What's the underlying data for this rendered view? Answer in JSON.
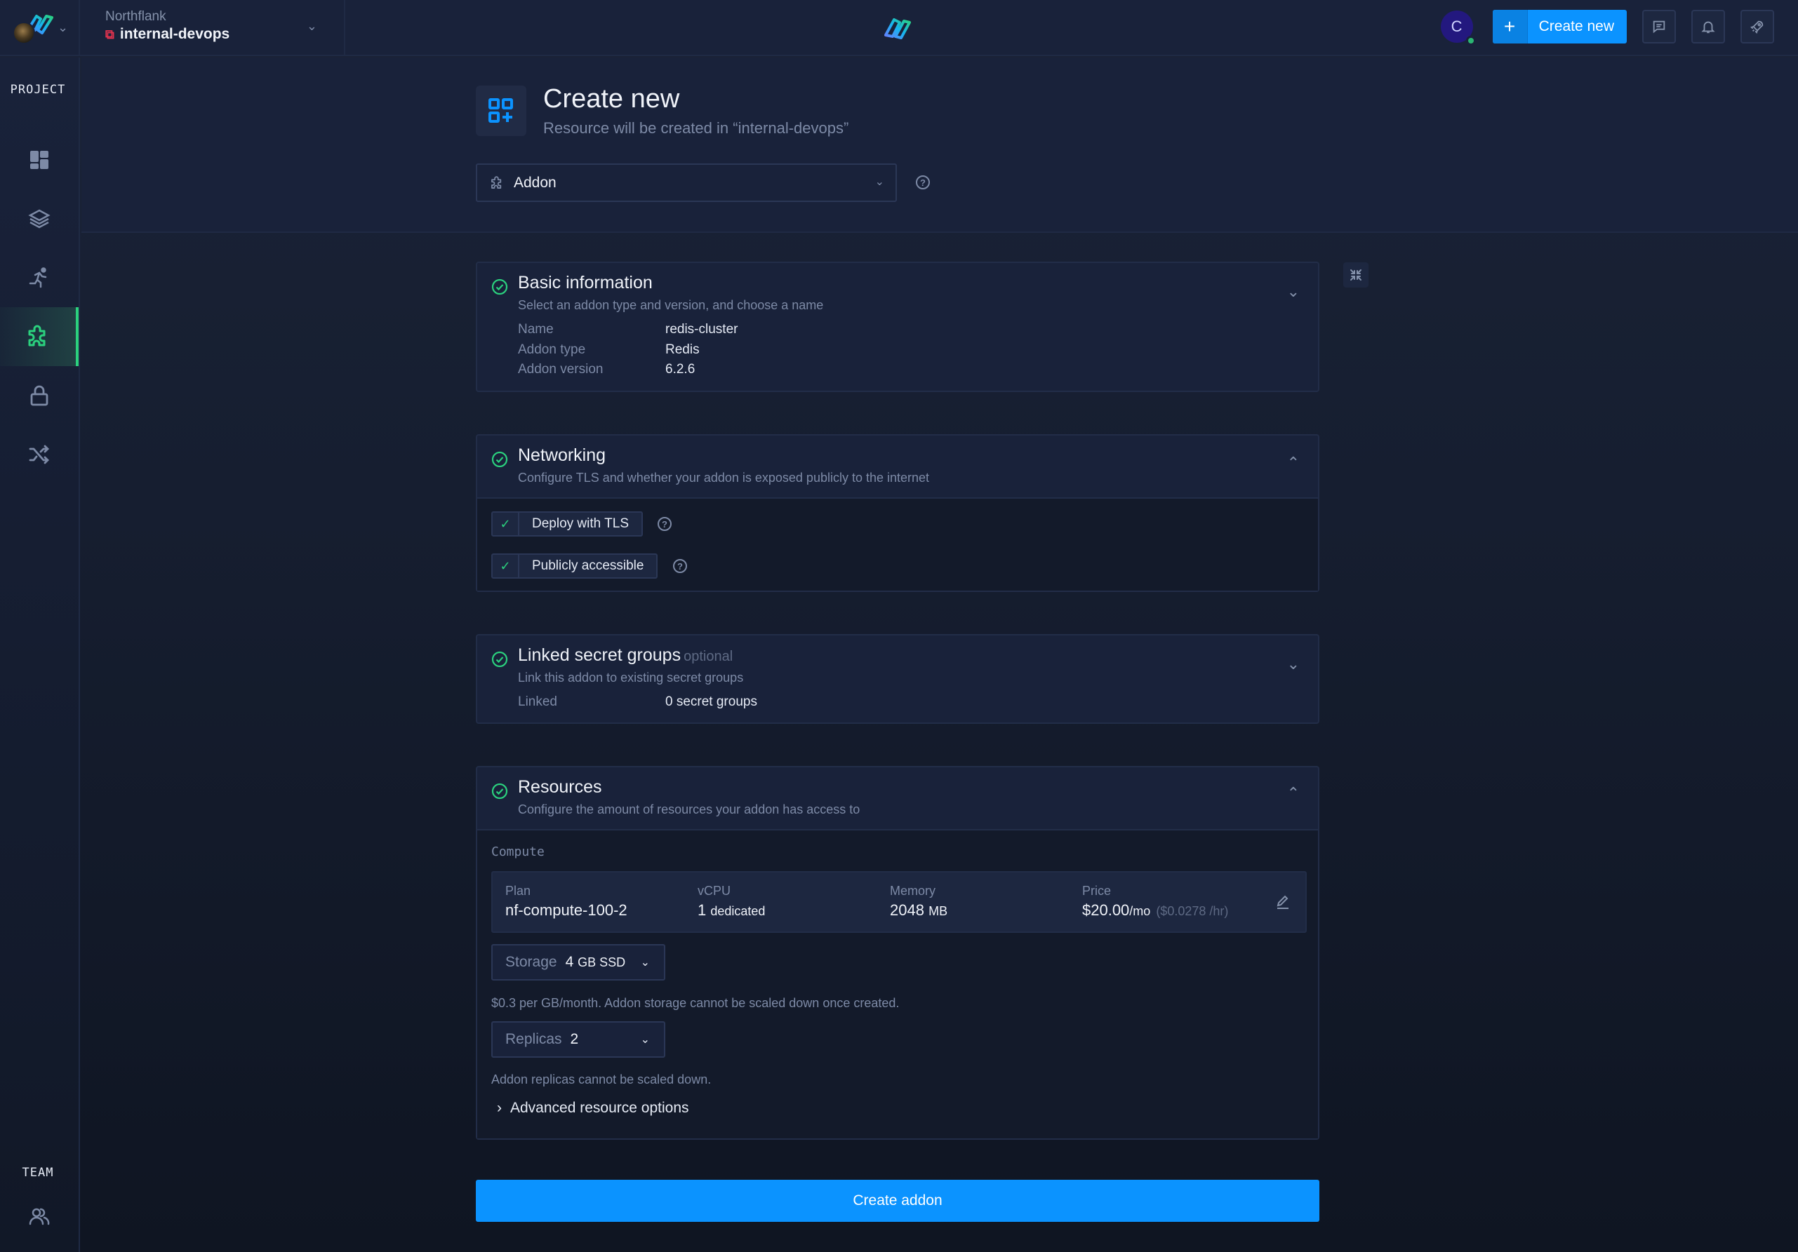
{
  "topbar": {
    "org_name": "Northflank",
    "project_name": "internal-devops",
    "user_initial": "C",
    "create_new_label": "Create new",
    "colors": {
      "primary": "#0b93ff",
      "online": "#2bb673",
      "project_icon": "#e5334e"
    }
  },
  "sidebar": {
    "project_label": "PROJECT",
    "team_label": "TEAM",
    "items": [
      {
        "icon": "dashboard-icon",
        "active": false
      },
      {
        "icon": "layers-icon",
        "active": false
      },
      {
        "icon": "running-job-icon",
        "active": false
      },
      {
        "icon": "puzzle-addon-icon",
        "active": true
      },
      {
        "icon": "lock-secrets-icon",
        "active": false
      },
      {
        "icon": "shuffle-pipeline-icon",
        "active": false
      }
    ],
    "team_items": [
      {
        "icon": "users-icon"
      }
    ],
    "active_color": "#2bd17e"
  },
  "header": {
    "title": "Create new",
    "subtitle": "Resource will be created in “internal-devops”",
    "resource_type": "Addon"
  },
  "sections": {
    "basic": {
      "title": "Basic information",
      "description": "Select an addon type and version, and choose a name",
      "fields": [
        {
          "label": "Name",
          "value": "redis-cluster"
        },
        {
          "label": "Addon type",
          "value": "Redis"
        },
        {
          "label": "Addon version",
          "value": "6.2.6"
        }
      ]
    },
    "networking": {
      "title": "Networking",
      "description": "Configure TLS and whether your addon is exposed publicly to the internet",
      "options": [
        {
          "label": "Deploy with TLS",
          "checked": true
        },
        {
          "label": "Publicly accessible",
          "checked": true
        }
      ]
    },
    "secrets": {
      "title": "Linked secret groups",
      "optional_tag": "optional",
      "description": "Link this addon to existing secret groups",
      "fields": [
        {
          "label": "Linked",
          "value": "0 secret groups"
        }
      ]
    },
    "resources": {
      "title": "Resources",
      "description": "Configure the amount of resources your addon has access to",
      "compute_label": "Compute",
      "plan": {
        "plan_label": "Plan",
        "plan_value": "nf-compute-100-2",
        "vcpu_label": "vCPU",
        "vcpu_value": "1",
        "vcpu_unit": "dedicated",
        "memory_label": "Memory",
        "memory_value": "2048",
        "memory_unit": "MB",
        "price_label": "Price",
        "price_value": "$20.00",
        "price_unit": "/mo",
        "price_hourly": "($0.0278 /hr)"
      },
      "storage": {
        "label": "Storage",
        "value": "4",
        "unit": "GB SSD",
        "hint": "$0.3 per GB/month. Addon storage cannot be scaled down once created."
      },
      "replicas": {
        "label": "Replicas",
        "value": "2",
        "hint": "Addon replicas cannot be scaled down."
      },
      "advanced_label": "Advanced resource options"
    }
  },
  "submit_label": "Create addon",
  "status_color": "#2bd17e"
}
